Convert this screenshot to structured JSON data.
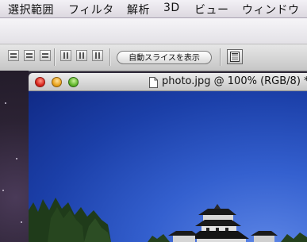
{
  "menubar": {
    "items": [
      {
        "label": "選択範囲"
      },
      {
        "label": "フィルタ"
      },
      {
        "label": "解析"
      },
      {
        "label": "3D"
      },
      {
        "label": "ビュー"
      },
      {
        "label": "ウィンドウ"
      }
    ]
  },
  "options_bar": {
    "auto_slices_label": "自動スライスを表示"
  },
  "document": {
    "title": "photo.jpg @ 100% (RGB/8) *"
  },
  "colors": {
    "sky_top": "#102a86",
    "sky_light": "#5d86e6",
    "trees": "#1f3b1a"
  }
}
